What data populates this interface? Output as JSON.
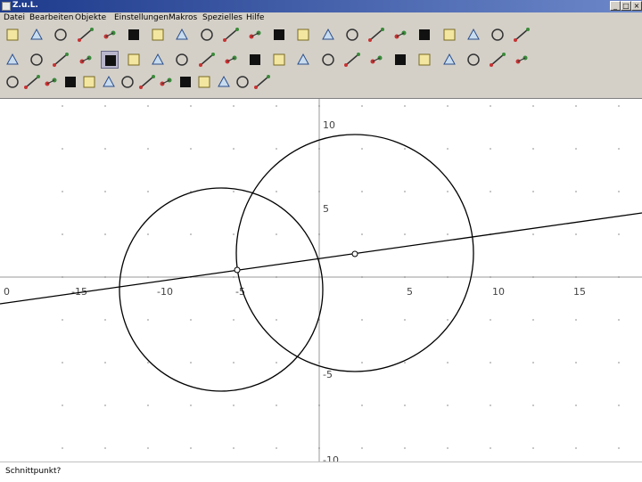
{
  "window": {
    "title": "Z.u.L."
  },
  "menu": [
    "Datei",
    "Bearbeiten",
    "Objekte",
    "Einstellungen",
    "Makros",
    "Spezielles",
    "Hilfe"
  ],
  "toolbar": {
    "row1": [
      "new-file-icon",
      "open-file-icon",
      "save-file-icon",
      "undo-icon",
      "delete-icon",
      "redo-icon",
      "edit-icon",
      "colorize-icon",
      "sort-icon",
      "grid-icon",
      "replay-icon",
      "document-icon",
      "function-icon",
      "show-hide-icon",
      "fill-black-icon",
      "point-style-icon",
      "line-style-icon",
      "zoom-icon",
      "axes-icon",
      "magic-icon",
      "color-palette-icon",
      "info-icon"
    ],
    "row2": [
      "point-tool-icon",
      "segment-tool-icon",
      "ray-tool-icon",
      "line-tool-icon",
      "circle-tool-icon",
      "circle-center-tool-icon",
      "fixed-circle-tool-icon",
      "parallel-tool-icon",
      "perpendicular-tool-icon",
      "midpoint-tool-icon",
      "angle-tool-icon",
      "fixed-angle-tool-icon",
      "move-tool-icon",
      "reflect-tool-icon",
      "intersect-tool-icon",
      "film-tool-icon",
      "expression-tool-icon",
      "polygon-tool-icon",
      "curve-tool-icon",
      "text-tool-icon",
      "draw-tool-icon",
      "settings-tool-icon"
    ],
    "row3": [
      "triangle-tool-icon",
      "arrow-tool-icon",
      "polygon-shape-icon",
      "bisector-tool-icon",
      "pencil-tool-icon",
      "cross-tool-icon",
      "locus-tool-icon",
      "circle3-tool-icon",
      "slash-tool-icon",
      "arc-tool-icon",
      "tangent-tool-icon",
      "hide-point-icon",
      "normal-tool-icon",
      "trace-tool-icon"
    ]
  },
  "canvas": {
    "x_ticks": [
      "0",
      "-15",
      "-10",
      "-5",
      "5",
      "10",
      "15"
    ],
    "y_ticks": [
      "10",
      "5",
      "-5",
      "-10"
    ]
  },
  "status": "Schnittpunkt?"
}
